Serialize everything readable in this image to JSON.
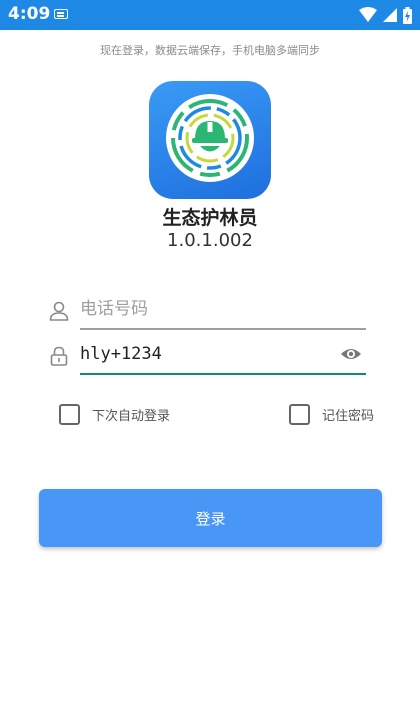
{
  "status_bar": {
    "time": "4:09",
    "icons": [
      "keyboard-icon",
      "wifi-icon",
      "signal-icon",
      "battery-charging-icon"
    ]
  },
  "hint": "现在登录，数据云端保存，手机电脑多端同步",
  "app": {
    "logo_icon": "forest-ranger-helmet-icon",
    "name": "生态护林员",
    "version": "1.0.1.002"
  },
  "form": {
    "phone_placeholder": "电话号码",
    "phone_value": "",
    "password_value": "hly+1234",
    "phone_icon": "user-icon",
    "password_icon": "lock-icon",
    "visibility_icon": "eye-icon"
  },
  "options": {
    "auto_login_label": "下次自动登录",
    "auto_login_checked": false,
    "remember_password_label": "记住密码",
    "remember_password_checked": false
  },
  "login_button": "登录",
  "colors": {
    "status_bar": "#1e88e5",
    "primary_button": "#4896f6",
    "password_underline": "#0f8a7a"
  }
}
